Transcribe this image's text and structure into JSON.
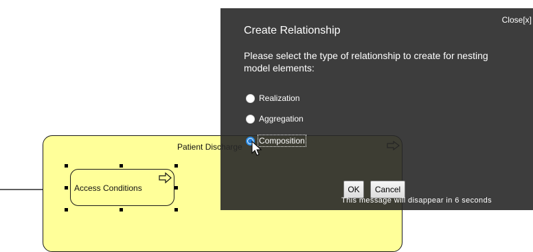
{
  "diagram": {
    "process_label": "Patient Discharge",
    "activity_label": "Access Conditions"
  },
  "dialog": {
    "close_label": "Close[x]",
    "title": "Create Relationship",
    "message": "Please select the type of relationship to create for nesting model elements:",
    "options": [
      {
        "label": "Realization",
        "selected": false
      },
      {
        "label": "Aggregation",
        "selected": false
      },
      {
        "label": "Composition",
        "selected": true
      }
    ],
    "ok_label": "OK",
    "cancel_label": "Cancel",
    "countdown": "This message will disappear in 6 seconds"
  },
  "colors": {
    "process_fill": "#ffff99",
    "dialog_bg": "#282828",
    "radio_selected": "#2d8fe8"
  }
}
